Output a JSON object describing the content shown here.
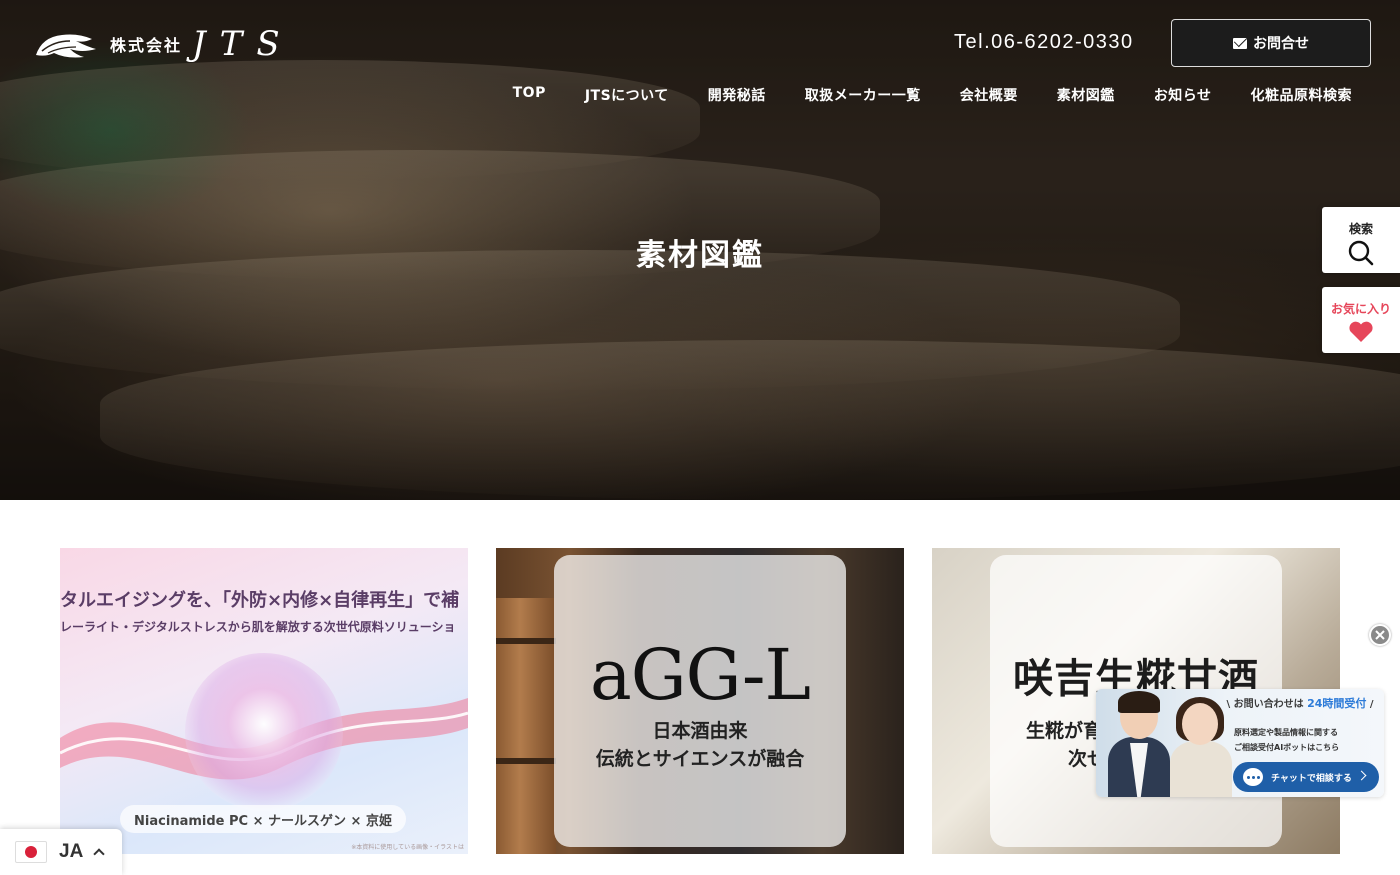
{
  "header": {
    "logo_kabushiki": "株式会社",
    "logo_name": "JTS",
    "tel": "Tel.06-6202-0330",
    "contact_label": "お問合せ"
  },
  "nav": {
    "items": [
      {
        "label": "TOP"
      },
      {
        "label": "JTSについて"
      },
      {
        "label": "開発秘話"
      },
      {
        "label": "取扱メーカー一覧"
      },
      {
        "label": "会社概要"
      },
      {
        "label": "素材図鑑"
      },
      {
        "label": "お知らせ"
      },
      {
        "label": "化粧品原料検索"
      }
    ]
  },
  "hero": {
    "title": "素材図鑑"
  },
  "side_tabs": {
    "search_label": "検索",
    "favorite_label": "お気に入り"
  },
  "cards": [
    {
      "headline": "タルエイジングを、「外防×内修×自律再生」で補",
      "sub": "レーライト・デジタルストレスから肌を解放する次世代原料ソリューショ",
      "pill": "Niacinamide PC × ナールスゲン × 京姫",
      "note": "※本資料に使用している画像・イラストは"
    },
    {
      "title": "aGG-L",
      "line1": "日本酒由来",
      "line2": "伝統とサイエンスが融合"
    },
    {
      "title": "咲吉生糀甘酒",
      "sub1": "生糀が育",
      "sub2": "次せ"
    }
  ],
  "chat": {
    "header_prefix": "お問い合わせは",
    "header_highlight": "24時間受付",
    "desc_line1": "原料選定や製品情報に関する",
    "desc_line2": "ご相談受付AIボットはこちら",
    "button_label": "チャットで相談する"
  },
  "language": {
    "code": "JA"
  },
  "colors": {
    "accent_red": "#e6465a",
    "chat_blue": "#1f5fa8",
    "highlight_blue": "#2d7bd8"
  }
}
